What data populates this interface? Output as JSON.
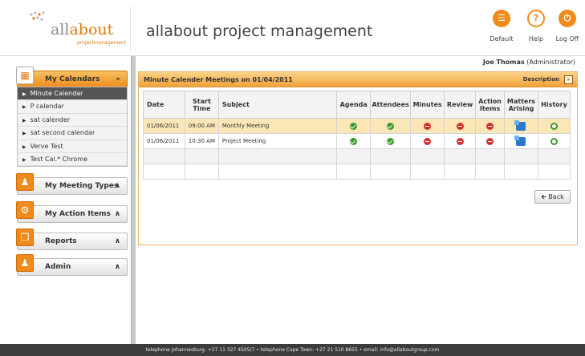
{
  "header": {
    "logo_text_a": "all",
    "logo_text_b": "about",
    "logo_sub": "projectmanagement",
    "title": "allabout project management",
    "buttons": [
      {
        "label": "Default",
        "icon": "default-view-icon"
      },
      {
        "label": "Help",
        "icon": "help-icon"
      },
      {
        "label": "Log Off",
        "icon": "power-icon"
      }
    ]
  },
  "user": {
    "name": "Joe Thomas",
    "role": "(Administrator)"
  },
  "sidebar": {
    "calendars_title": "My Calendars",
    "calendars": [
      "Minute Calendar",
      "P calendar",
      "sat calender",
      "sat second calendar",
      "Verve Test",
      "Test Cal.* Chrome"
    ],
    "meeting_types_title": "My Meeting Types",
    "action_items_title": "My Action Items",
    "reports_title": "Reports",
    "admin_title": "Admin"
  },
  "panel": {
    "title": "Minute Calender Meetings on 01/04/2011",
    "description_label": "Description",
    "columns": [
      "Date",
      "Start Time",
      "Subject",
      "Agenda",
      "Attendees",
      "Minutes",
      "Review",
      "Action Items",
      "Matters Arising",
      "History"
    ],
    "rows": [
      {
        "date": "01/06/2011",
        "time": "09:00 AM",
        "subject": "Monthly Meeting",
        "agenda": "complete",
        "attendees": "complete",
        "minutes": "not-started",
        "review": "not-started",
        "action_items": "not-started",
        "matters_arising": "available",
        "history": "available"
      },
      {
        "date": "01/06/2011",
        "time": "10:30 AM",
        "subject": "Project Meeting",
        "agenda": "complete",
        "attendees": "complete",
        "minutes": "not-started",
        "review": "not-started",
        "action_items": "not-started",
        "matters_arising": "available",
        "history": "available"
      }
    ],
    "back_label": "Back"
  },
  "footer": {
    "text": "telephone Johannesburg: +27 11 327 4505/7 • telephone Cape Town: +27 21 510 8655 • email: info@allaboutgroup.com"
  },
  "colors": {
    "accent": "#f08a1c",
    "highlight_row": "#fbe6b6",
    "footer_bg": "#3c3c3c"
  }
}
